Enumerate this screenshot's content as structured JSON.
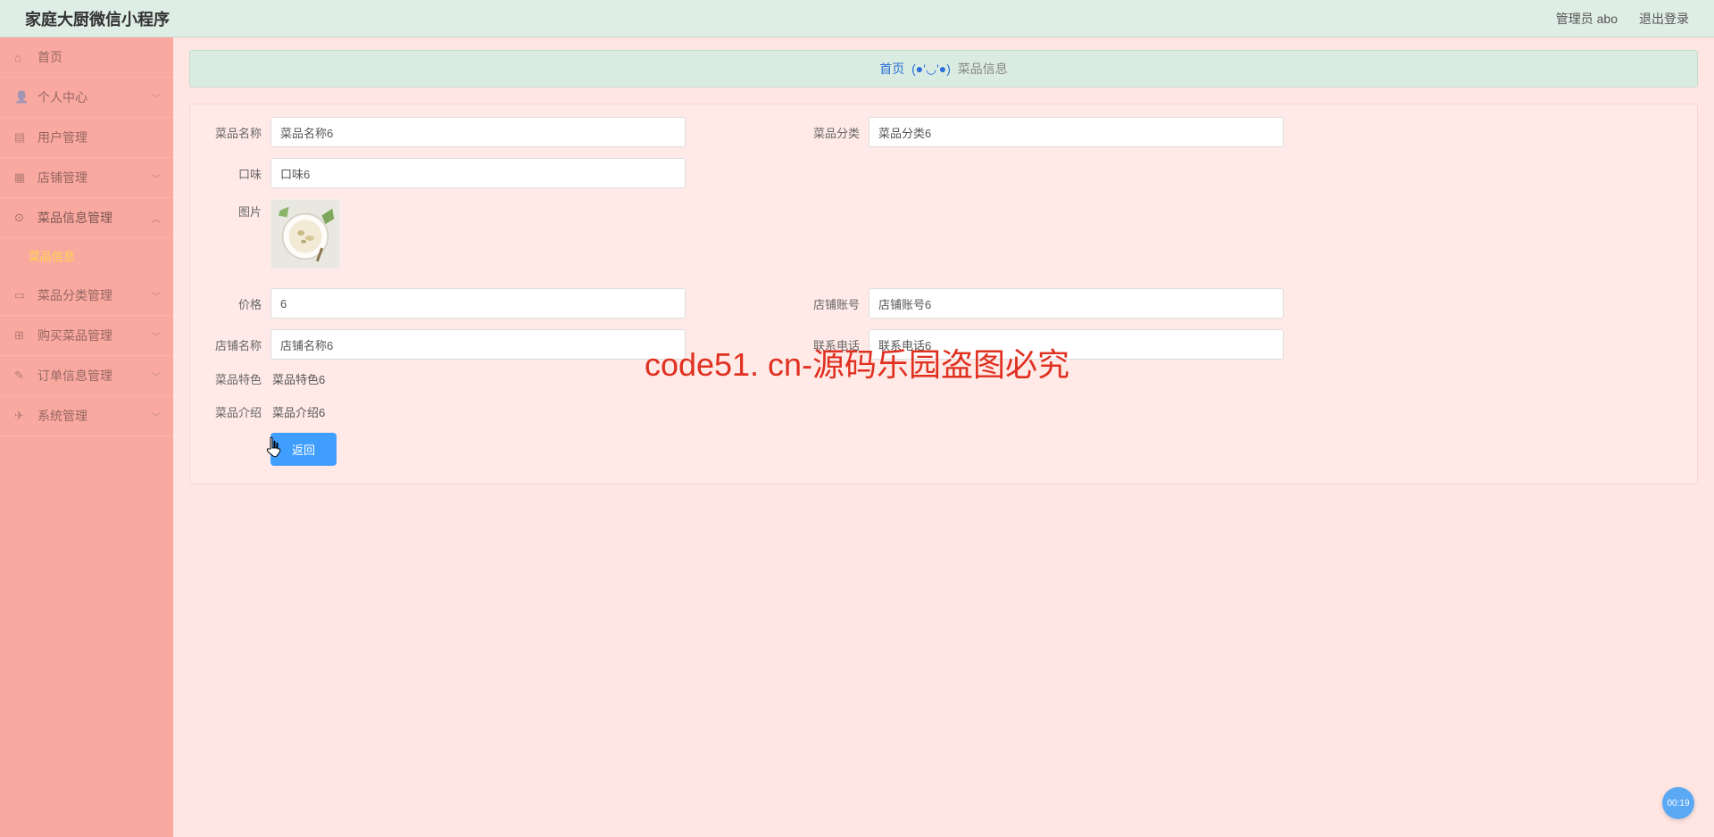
{
  "header": {
    "title": "家庭大厨微信小程序",
    "admin_label": "管理员 abo",
    "logout_label": "退出登录"
  },
  "sidebar": {
    "items": [
      {
        "icon": "home-icon",
        "glyph": "⌂",
        "label": "首页",
        "chevron": false
      },
      {
        "icon": "user-icon",
        "glyph": "👤",
        "label": "个人中心",
        "chevron": true
      },
      {
        "icon": "users-icon",
        "glyph": "▤",
        "label": "用户管理",
        "chevron": false
      },
      {
        "icon": "store-icon",
        "glyph": "▦",
        "label": "店铺管理",
        "chevron": true
      },
      {
        "icon": "dish-info-icon",
        "glyph": "⊙",
        "label": "菜品信息管理",
        "chevron": true,
        "expanded": true
      },
      {
        "icon": "category-icon",
        "glyph": "▭",
        "label": "菜品分类管理",
        "chevron": true
      },
      {
        "icon": "buy-icon",
        "glyph": "⊞",
        "label": "购买菜品管理",
        "chevron": true
      },
      {
        "icon": "order-icon",
        "glyph": "✎",
        "label": "订单信息管理",
        "chevron": true
      },
      {
        "icon": "system-icon",
        "glyph": "✈",
        "label": "系统管理",
        "chevron": true
      }
    ],
    "submenu_label": "菜品信息"
  },
  "breadcrumb": {
    "home": "首页",
    "face": "(●'◡'●)",
    "current": "菜品信息"
  },
  "form": {
    "labels": {
      "name": "菜品名称",
      "category": "菜品分类",
      "taste": "口味",
      "image": "图片",
      "price": "价格",
      "shop_account": "店铺账号",
      "shop_name": "店铺名称",
      "phone": "联系电话",
      "feature": "菜品特色",
      "intro": "菜品介绍"
    },
    "values": {
      "name": "菜品名称6",
      "category": "菜品分类6",
      "taste": "口味6",
      "price": "6",
      "shop_account": "店铺账号6",
      "shop_name": "店铺名称6",
      "phone": "联系电话6",
      "feature": "菜品特色6",
      "intro": "菜品介绍6"
    },
    "back_button": "返回"
  },
  "watermark": {
    "text": "code51.cn",
    "central": "code51. cn-源码乐园盗图必究"
  },
  "badge": {
    "time": "00:19"
  }
}
